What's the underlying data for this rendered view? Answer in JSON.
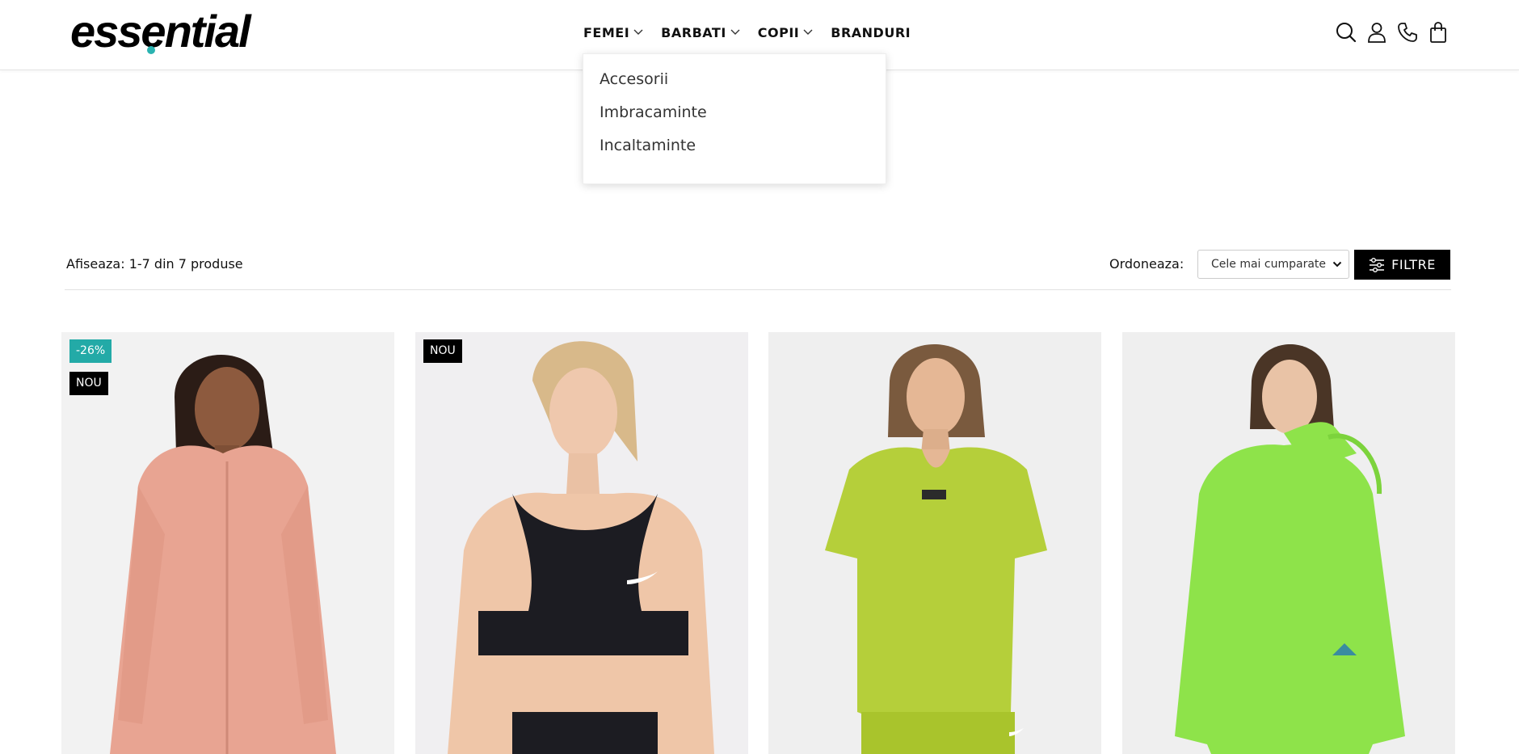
{
  "header": {
    "logo": "essential",
    "nav": [
      {
        "label": "FEMEI",
        "has_dropdown": true
      },
      {
        "label": "BARBATI",
        "has_dropdown": true
      },
      {
        "label": "COPII",
        "has_dropdown": true
      },
      {
        "label": "BRANDURI",
        "has_dropdown": false
      }
    ],
    "icons": [
      "search-icon",
      "user-icon",
      "phone-icon",
      "cart-icon"
    ]
  },
  "dropdown": {
    "items": [
      "Accesorii",
      "Imbracaminte",
      "Incaltaminte"
    ]
  },
  "toolbar": {
    "count_text": "Afiseaza: 1-7 din 7 produse",
    "sort_label": "Ordoneaza:",
    "sort_value": "Cele mai cumparate",
    "filter_label": "FILTRE"
  },
  "products": [
    {
      "badges": [
        "-26%",
        "NOU"
      ],
      "garment_color": "#e8a492",
      "image": "pink-jacket"
    },
    {
      "badges": [
        "NOU"
      ],
      "garment_color": "#1c1c22",
      "image": "black-sports-bra"
    },
    {
      "badges": [],
      "garment_color": "#b5cf3a",
      "image": "lime-tshirt"
    },
    {
      "badges": [],
      "garment_color": "#8ee34a",
      "image": "green-hooded-jacket"
    }
  ],
  "colors": {
    "accent": "#2ab3b1",
    "discount_badge": "#23aaa7",
    "new_badge": "#000000",
    "filter_button": "#000000"
  }
}
